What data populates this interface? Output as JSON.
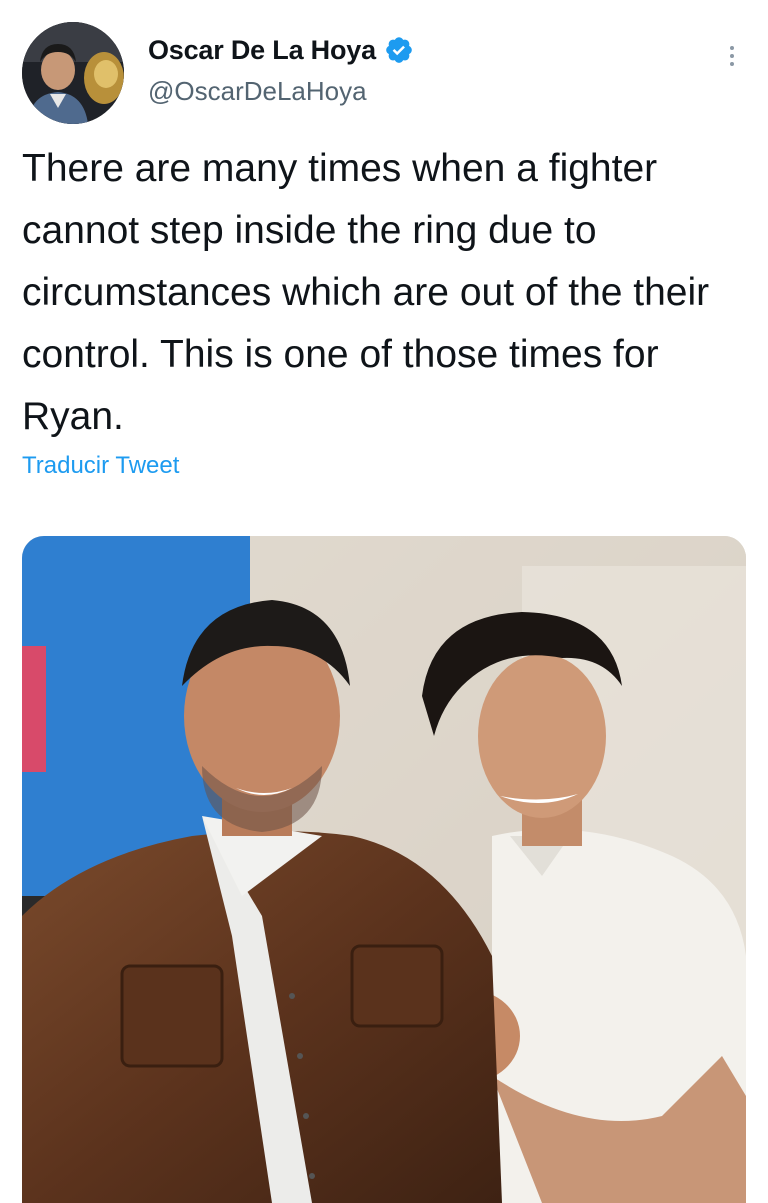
{
  "tweet": {
    "author": {
      "display_name": "Oscar De La Hoya",
      "handle": "@OscarDeLaHoya",
      "verified": true
    },
    "text": "There are many times when a fighter cannot step inside the ring due to circumstances which are out of the their control. This is one of those times for Ryan.",
    "translate_label": "Traducir Tweet",
    "icons": {
      "verified": "verified-badge-icon",
      "more": "more-options-icon"
    },
    "colors": {
      "accent": "#1d9bf0",
      "text": "#0f1419",
      "secondary": "#536471"
    }
  }
}
